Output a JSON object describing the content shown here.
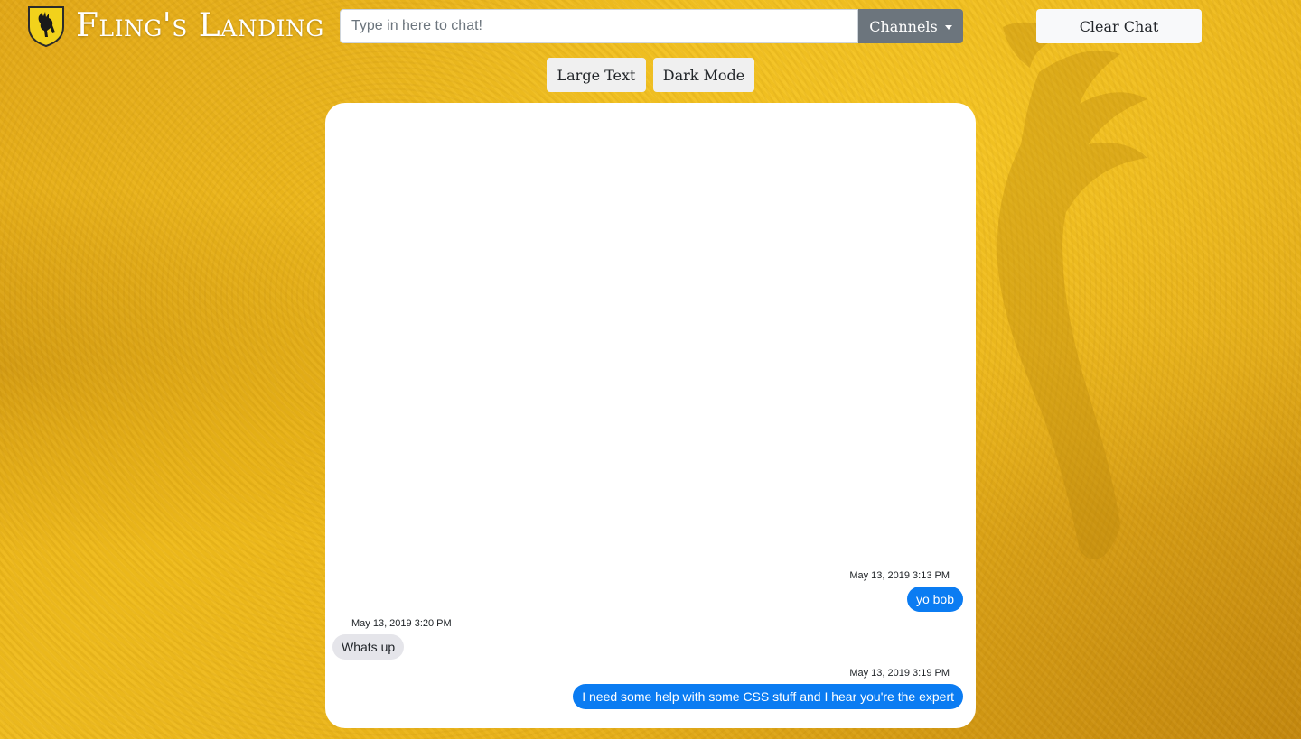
{
  "header": {
    "brand": "Fling's Landing",
    "chat_placeholder": "Type in here to chat!",
    "channels_label": "Channels",
    "clear_label": "Clear Chat"
  },
  "options": {
    "large_text_label": "Large Text",
    "dark_mode_label": "Dark Mode"
  },
  "messages": [
    {
      "timestamp": "May 13, 2019 3:13 PM",
      "text": "yo bob",
      "direction": "sent"
    },
    {
      "timestamp": "May 13, 2019 3:20 PM",
      "text": "Whats up",
      "direction": "received"
    },
    {
      "timestamp": "May 13, 2019 3:19 PM",
      "text": "I need some help with some CSS stuff and I hear you're the expert",
      "direction": "sent"
    }
  ],
  "colors": {
    "sent_bubble": "#0b7cf2",
    "received_bubble": "#e5e5ea",
    "background": "#e9b21a",
    "channels_button": "#6c757d"
  },
  "icons": {
    "logo": "stag-shield-icon",
    "channels_toggle": "caret-down-icon"
  }
}
